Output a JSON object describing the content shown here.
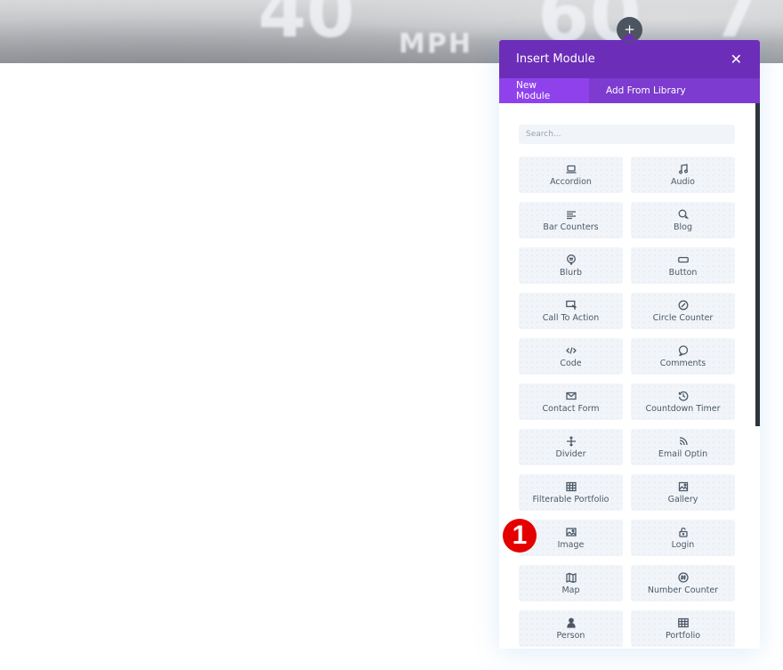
{
  "background": {
    "speedometer_text": [
      "40",
      "MPH",
      "60",
      "7"
    ]
  },
  "add_button": {
    "icon": "plus-icon",
    "glyph": "+"
  },
  "modal": {
    "title": "Insert Module",
    "close_glyph": "✕",
    "tabs": [
      {
        "label": "New Module",
        "active": true
      },
      {
        "label": "Add From Library",
        "active": false
      }
    ],
    "search": {
      "placeholder": "Search...",
      "value": ""
    },
    "modules": [
      {
        "label": "Accordion",
        "icon": "laptop-icon"
      },
      {
        "label": "Audio",
        "icon": "music-note-icon"
      },
      {
        "label": "Bar Counters",
        "icon": "align-left-icon"
      },
      {
        "label": "Blog",
        "icon": "chat-bubbles-icon"
      },
      {
        "label": "Blurb",
        "icon": "message-pin-icon"
      },
      {
        "label": "Button",
        "icon": "button-rectangle-icon"
      },
      {
        "label": "Call To Action",
        "icon": "monitor-cursor-icon"
      },
      {
        "label": "Circle Counter",
        "icon": "circle-slash-icon"
      },
      {
        "label": "Code",
        "icon": "code-brackets-icon"
      },
      {
        "label": "Comments",
        "icon": "comment-icon"
      },
      {
        "label": "Contact Form",
        "icon": "envelope-icon"
      },
      {
        "label": "Countdown Timer",
        "icon": "history-clock-icon"
      },
      {
        "label": "Divider",
        "icon": "divider-arrows-icon"
      },
      {
        "label": "Email Optin",
        "icon": "rss-icon"
      },
      {
        "label": "Filterable Portfolio",
        "icon": "grid-table-icon"
      },
      {
        "label": "Gallery",
        "icon": "gallery-images-icon"
      },
      {
        "label": "Image",
        "icon": "image-icon"
      },
      {
        "label": "Login",
        "icon": "unlock-icon"
      },
      {
        "label": "Map",
        "icon": "map-icon"
      },
      {
        "label": "Number Counter",
        "icon": "hash-circle-icon"
      },
      {
        "label": "Person",
        "icon": "person-icon"
      },
      {
        "label": "Portfolio",
        "icon": "table-grid-icon"
      }
    ]
  },
  "annotation": {
    "label": "1"
  },
  "colors": {
    "header_purple": "#6c2eb9",
    "tabs_purple": "#7d3bcf",
    "active_tab": "#8f42ec",
    "card_bg": "#f1f5f9",
    "badge_red": "#e50000"
  }
}
